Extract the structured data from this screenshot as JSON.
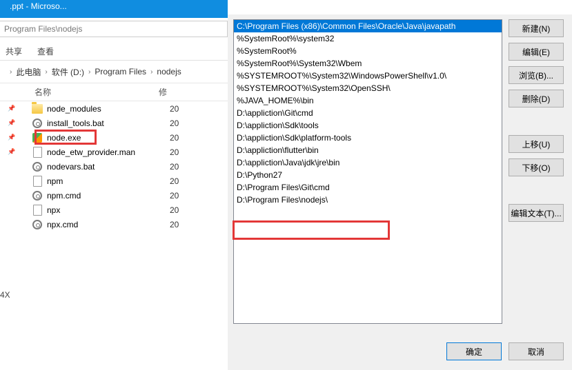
{
  "taskbar": {
    "label": ".ppt - Microso..."
  },
  "address": "Program Files\\nodejs",
  "tabs": [
    "共享",
    "查看"
  ],
  "breadcrumb": [
    "此电脑",
    "软件 (D:)",
    "Program Files",
    "nodejs"
  ],
  "columns": {
    "name": "名称",
    "date": "修"
  },
  "files": [
    {
      "icon": "folder",
      "name": "node_modules",
      "date": "20",
      "pinned": true
    },
    {
      "icon": "gear",
      "name": "install_tools.bat",
      "date": "20",
      "pinned": true
    },
    {
      "icon": "exe",
      "name": "node.exe",
      "date": "20",
      "pinned": true
    },
    {
      "icon": "doc",
      "name": "node_etw_provider.man",
      "date": "20",
      "pinned": true
    },
    {
      "icon": "gear",
      "name": "nodevars.bat",
      "date": "20",
      "pinned": false
    },
    {
      "icon": "doc",
      "name": "npm",
      "date": "20",
      "pinned": false
    },
    {
      "icon": "gear",
      "name": "npm.cmd",
      "date": "20",
      "pinned": false
    },
    {
      "icon": "doc",
      "name": "npx",
      "date": "20",
      "pinned": false
    },
    {
      "icon": "gear",
      "name": "npx.cmd",
      "date": "20",
      "pinned": false
    }
  ],
  "status": "4X",
  "paths": [
    "C:\\Program Files (x86)\\Common Files\\Oracle\\Java\\javapath",
    "%SystemRoot%\\system32",
    "%SystemRoot%",
    "%SystemRoot%\\System32\\Wbem",
    "%SYSTEMROOT%\\System32\\WindowsPowerShell\\v1.0\\",
    "%SYSTEMROOT%\\System32\\OpenSSH\\",
    "%JAVA_HOME%\\bin",
    "D:\\appliction\\Git\\cmd",
    "D:\\appliction\\Sdk\\tools",
    "D:\\appliction\\Sdk\\platform-tools",
    "D:\\appliction\\flutter\\bin",
    "D:\\appliction\\Java\\jdk\\jre\\bin",
    "D:\\Python27",
    "D:\\Program Files\\Git\\cmd",
    "D:\\Program Files\\nodejs\\"
  ],
  "selected_index": 0,
  "buttons": {
    "new_": "新建(N)",
    "edit": "编辑(E)",
    "browse": "浏览(B)...",
    "del": "删除(D)",
    "up": "上移(U)",
    "down": "下移(O)",
    "etext": "编辑文本(T)...",
    "ok": "确定",
    "cancel": "取消"
  }
}
